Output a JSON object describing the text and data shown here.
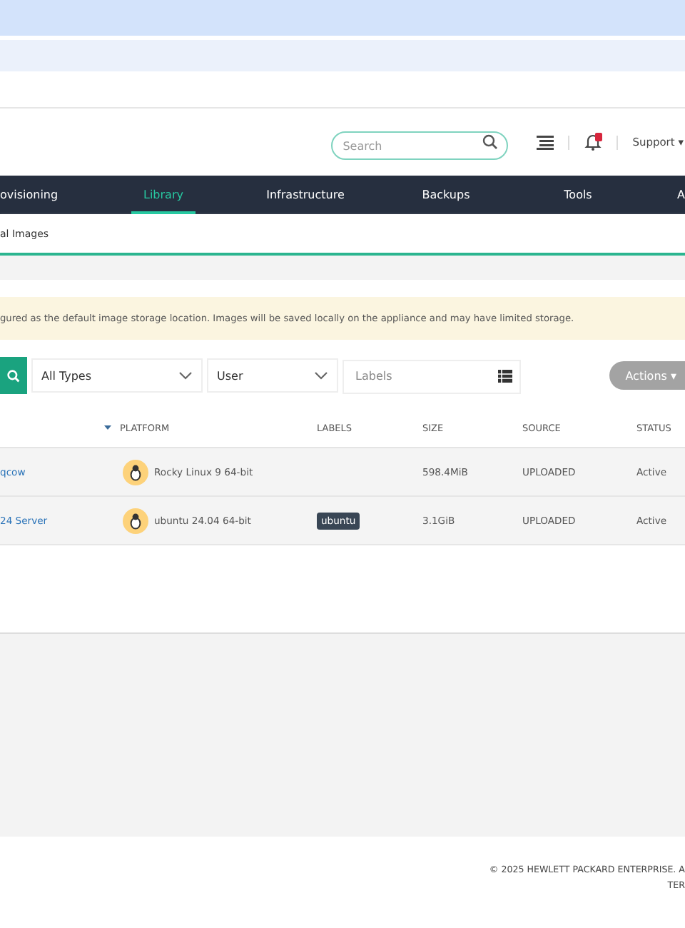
{
  "header": {
    "search": {
      "placeholder": "Search"
    },
    "notifications": {
      "has_alert": true
    },
    "support": "Support ▾"
  },
  "nav": [
    {
      "label": "ovisioning",
      "selected": false
    },
    {
      "label": "Library",
      "selected": true
    },
    {
      "label": "Infrastructure",
      "selected": false
    },
    {
      "label": "Backups",
      "selected": false
    },
    {
      "label": "Tools",
      "selected": false
    },
    {
      "label": "A",
      "selected": false
    }
  ],
  "subnav": [
    "al Images"
  ],
  "banner": "gured as the default image storage location. Images will be saved locally on the appliance and may have limited storage.",
  "filters": {
    "type": "All Types",
    "owner": "User",
    "labels": {
      "placeholder": "Labels"
    },
    "actions": "Actions ▾"
  },
  "table": {
    "columns": [
      "",
      "PLATFORM",
      "LABELS",
      "SIZE",
      "SOURCE",
      "STATUS"
    ],
    "rows": [
      {
        "name": "qcow",
        "platform": "Rocky Linux 9 64-bit",
        "labels": [],
        "size": "598.4MiB",
        "source": "UPLOADED",
        "status": "Active"
      },
      {
        "name": "24 Server",
        "platform": "ubuntu 24.04 64-bit",
        "labels": [
          "ubuntu"
        ],
        "size": "3.1GiB",
        "source": "UPLOADED",
        "status": "Active"
      }
    ]
  },
  "footer": {
    "copyright": "© 2025 HEWLETT PACKARD ENTERPRISE. A",
    "links": "TER"
  }
}
